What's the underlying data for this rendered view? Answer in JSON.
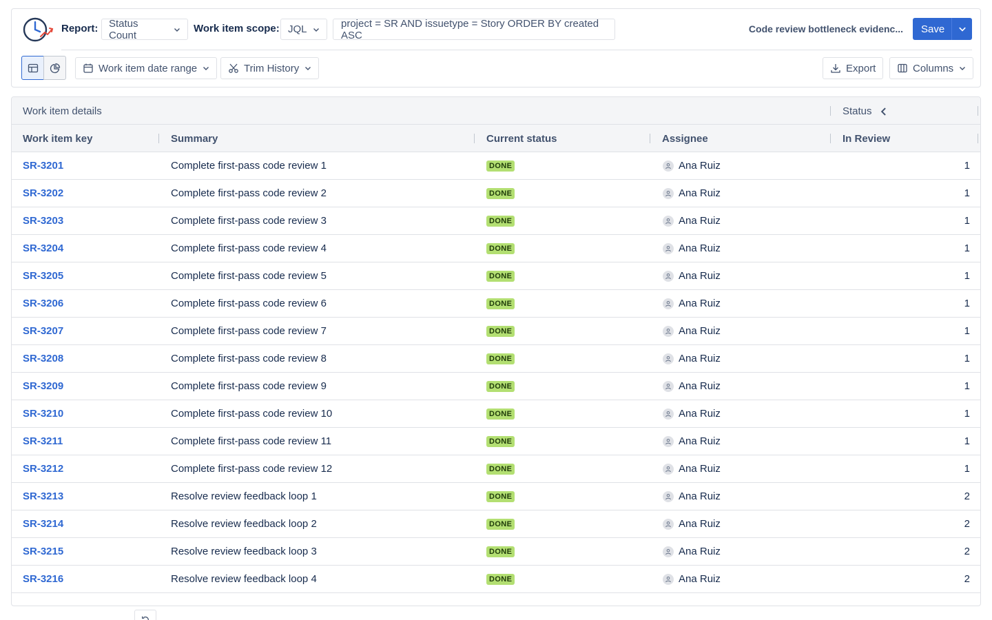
{
  "header": {
    "report_label": "Report:",
    "report_value": "Status Count",
    "scope_label": "Work item scope:",
    "scope_type": "JQL",
    "jql": "project = SR AND issuetype = Story ORDER BY created ASC",
    "report_name": "Code review bottleneck evidenc...",
    "save_label": "Save"
  },
  "toolbar": {
    "date_range_label": "Work item date range",
    "trim_label": "Trim History",
    "export_label": "Export",
    "columns_label": "Columns"
  },
  "table": {
    "group_left": "Work item details",
    "group_right": "Status",
    "columns": {
      "key": "Work item key",
      "summary": "Summary",
      "status": "Current status",
      "assignee": "Assignee",
      "in_review": "In Review"
    },
    "rows": [
      {
        "key": "SR-3201",
        "summary": "Complete first-pass code review 1",
        "status": "DONE",
        "assignee": "Ana Ruiz",
        "in_review": "1"
      },
      {
        "key": "SR-3202",
        "summary": "Complete first-pass code review 2",
        "status": "DONE",
        "assignee": "Ana Ruiz",
        "in_review": "1"
      },
      {
        "key": "SR-3203",
        "summary": "Complete first-pass code review 3",
        "status": "DONE",
        "assignee": "Ana Ruiz",
        "in_review": "1"
      },
      {
        "key": "SR-3204",
        "summary": "Complete first-pass code review 4",
        "status": "DONE",
        "assignee": "Ana Ruiz",
        "in_review": "1"
      },
      {
        "key": "SR-3205",
        "summary": "Complete first-pass code review 5",
        "status": "DONE",
        "assignee": "Ana Ruiz",
        "in_review": "1"
      },
      {
        "key": "SR-3206",
        "summary": "Complete first-pass code review 6",
        "status": "DONE",
        "assignee": "Ana Ruiz",
        "in_review": "1"
      },
      {
        "key": "SR-3207",
        "summary": "Complete first-pass code review 7",
        "status": "DONE",
        "assignee": "Ana Ruiz",
        "in_review": "1"
      },
      {
        "key": "SR-3208",
        "summary": "Complete first-pass code review 8",
        "status": "DONE",
        "assignee": "Ana Ruiz",
        "in_review": "1"
      },
      {
        "key": "SR-3209",
        "summary": "Complete first-pass code review 9",
        "status": "DONE",
        "assignee": "Ana Ruiz",
        "in_review": "1"
      },
      {
        "key": "SR-3210",
        "summary": "Complete first-pass code review 10",
        "status": "DONE",
        "assignee": "Ana Ruiz",
        "in_review": "1"
      },
      {
        "key": "SR-3211",
        "summary": "Complete first-pass code review 11",
        "status": "DONE",
        "assignee": "Ana Ruiz",
        "in_review": "1"
      },
      {
        "key": "SR-3212",
        "summary": "Complete first-pass code review 12",
        "status": "DONE",
        "assignee": "Ana Ruiz",
        "in_review": "1"
      },
      {
        "key": "SR-3213",
        "summary": "Resolve review feedback loop 1",
        "status": "DONE",
        "assignee": "Ana Ruiz",
        "in_review": "2"
      },
      {
        "key": "SR-3214",
        "summary": "Resolve review feedback loop 2",
        "status": "DONE",
        "assignee": "Ana Ruiz",
        "in_review": "2"
      },
      {
        "key": "SR-3215",
        "summary": "Resolve review feedback loop 3",
        "status": "DONE",
        "assignee": "Ana Ruiz",
        "in_review": "2"
      },
      {
        "key": "SR-3216",
        "summary": "Resolve review feedback loop 4",
        "status": "DONE",
        "assignee": "Ana Ruiz",
        "in_review": "2"
      }
    ]
  },
  "colors": {
    "accent": "#2f68d2",
    "done_badge": "#b3df72"
  }
}
